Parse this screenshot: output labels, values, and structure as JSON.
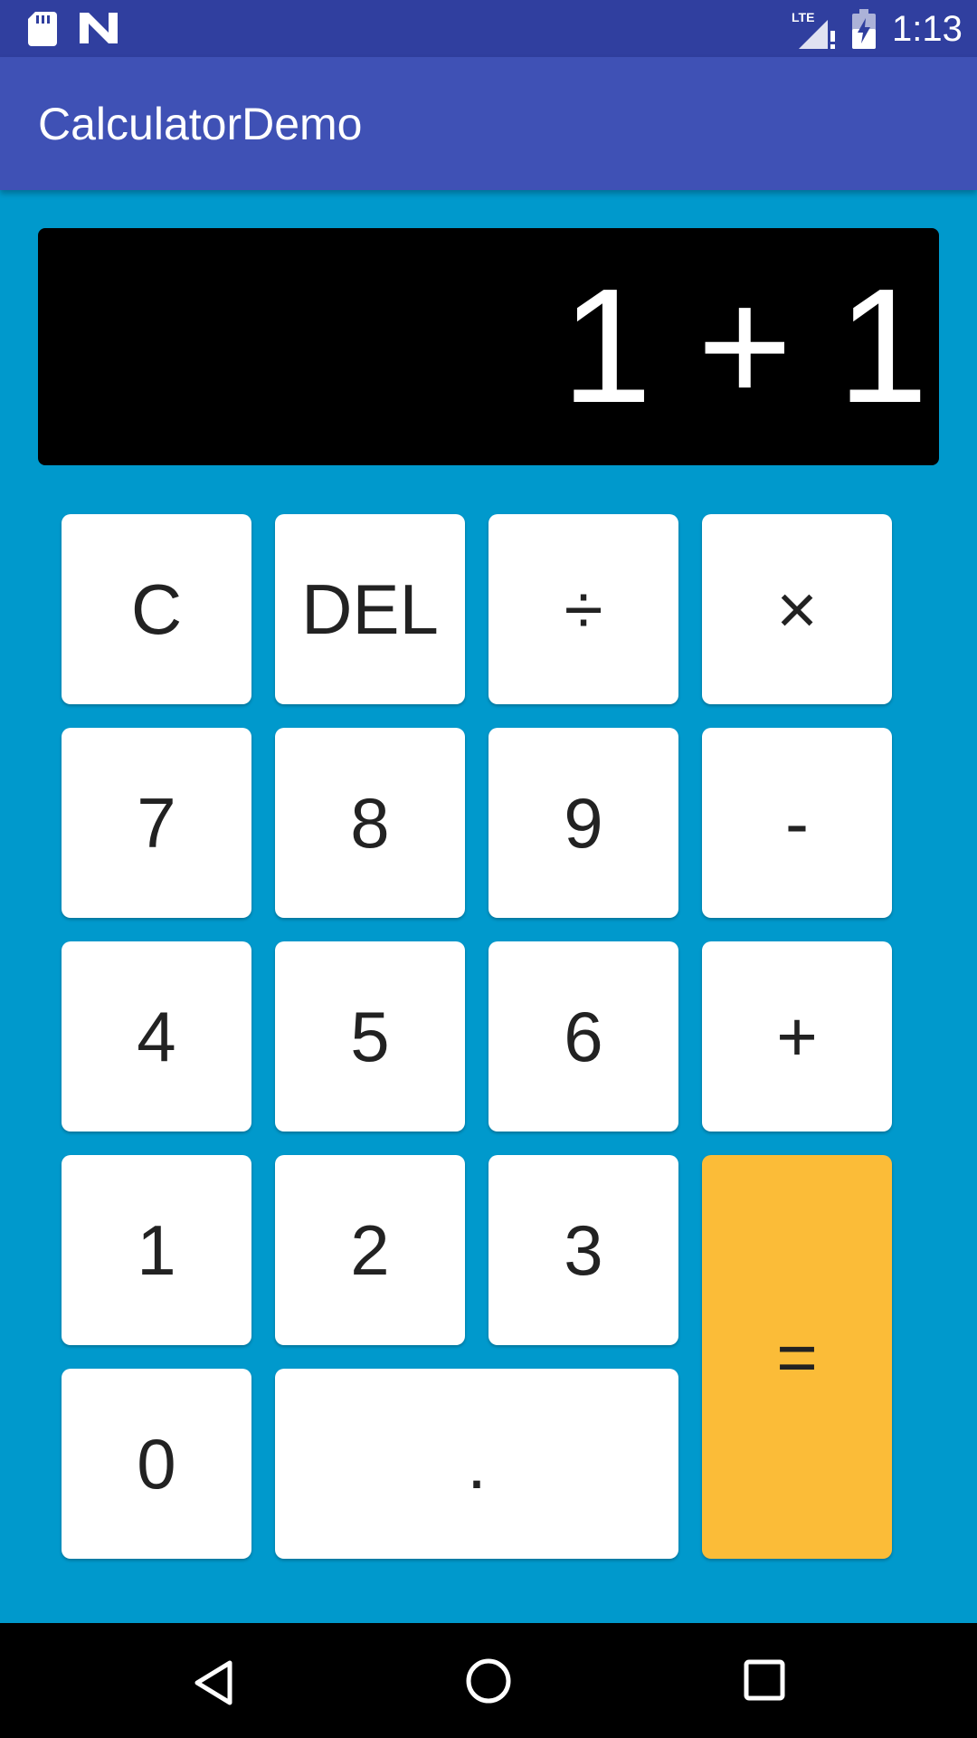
{
  "status_bar": {
    "time": "1:13",
    "icons": [
      "sd-card-icon",
      "n-logo-icon",
      "lte-signal-icon",
      "battery-charging-icon"
    ],
    "signal_label": "LTE"
  },
  "app_bar": {
    "title": "CalculatorDemo",
    "color": "#3f51b5"
  },
  "display": {
    "expression": "1 + 1"
  },
  "keypad": {
    "clear": "C",
    "delete": "DEL",
    "divide": "÷",
    "multiply": "×",
    "seven": "7",
    "eight": "8",
    "nine": "9",
    "subtract": "-",
    "four": "4",
    "five": "5",
    "six": "6",
    "add": "+",
    "one": "1",
    "two": "2",
    "three": "3",
    "equals": "=",
    "zero": "0",
    "decimal": "."
  },
  "colors": {
    "background": "#0099cc",
    "key": "#ffffff",
    "equals_key": "#fbbc38",
    "display": "#000000",
    "status_bar": "#303f9f"
  },
  "nav_bar": {
    "icons": [
      "back-icon",
      "home-icon",
      "recents-icon"
    ]
  }
}
